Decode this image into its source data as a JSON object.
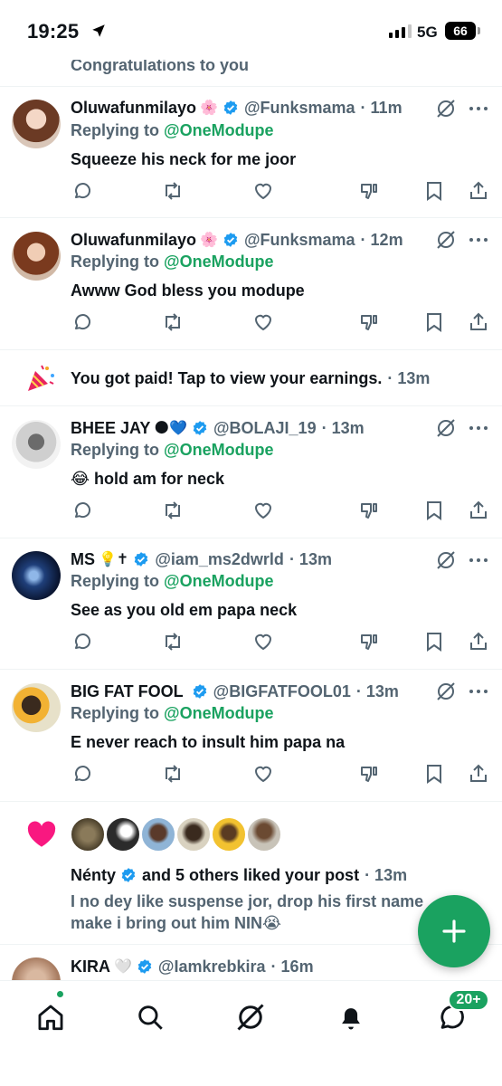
{
  "status_bar": {
    "time": "19:25",
    "network": "5G",
    "battery": "66"
  },
  "top_partial": {
    "text": "Congratulations to you"
  },
  "notifications": [
    {
      "name": "Oluwafunmilayo",
      "emoji": "🌸",
      "handle": "@Funksmama",
      "time": "· 11m",
      "replying_prefix": "Replying to",
      "replying_to": "@OneModupe",
      "text": "Squeeze his neck for me joor"
    },
    {
      "name": "Oluwafunmilayo",
      "emoji": "🌸",
      "handle": "@Funksmama",
      "time": "· 12m",
      "replying_prefix": "Replying to",
      "replying_to": "@OneModupe",
      "text": "Awww God bless you modupe"
    },
    {
      "name": "BHEE JAY",
      "emoji": "🌑💙",
      "handle": "@BOLAJI_19",
      "time": "· 13m",
      "replying_prefix": "Replying to",
      "replying_to": "@OneModupe",
      "text": "😂 hold am for neck"
    },
    {
      "name": "MS",
      "emoji": "💡✝",
      "handle": "@iam_ms2dwrld",
      "time": "· 13m",
      "replying_prefix": "Replying to",
      "replying_to": "@OneModupe",
      "text": "See as you old em papa neck"
    },
    {
      "name": "BIG FAT FOOL",
      "emoji": "",
      "handle": "@BIGFATFOOL01",
      "time": "· 13m",
      "replying_prefix": "Replying to",
      "replying_to": "@OneModupe",
      "text": "E never reach to insult him papa na"
    }
  ],
  "payout": {
    "icon": "party-popper-icon",
    "text": "You got paid! Tap to view your earnings.",
    "time": "· 13m"
  },
  "like_notification": {
    "name": "Nénty",
    "rest": "and 5 others liked your post",
    "time": "· 13m",
    "post_line1": "I no dey like suspense jor, drop his first name",
    "post_line2": "make i bring out him NIN😭"
  },
  "bottom_partial": {
    "name": "KIRA",
    "emoji": "🤍",
    "handle": "@Iamkrebkira",
    "time": "· 16m"
  },
  "tabbar": {
    "items": [
      "home-icon",
      "search-icon",
      "grok-icon",
      "notifications-icon",
      "messages-icon"
    ],
    "messages_badge": "20+"
  },
  "colors": {
    "accent": "#1aa260",
    "verified": "#1d9bf0",
    "secondary": "#536471",
    "like": "#f91880"
  }
}
